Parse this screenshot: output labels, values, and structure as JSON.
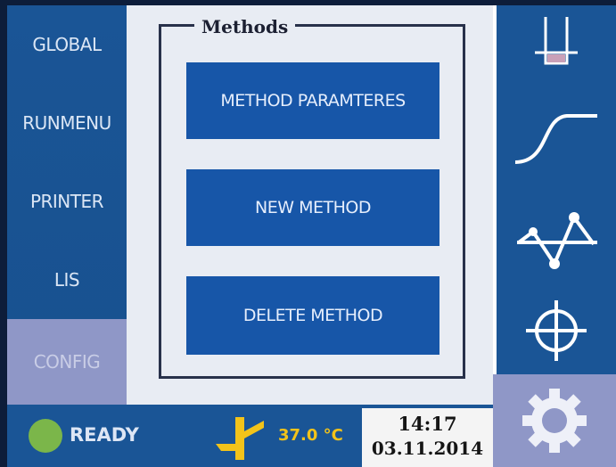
{
  "nav": {
    "items": [
      {
        "label": "GLOBAL",
        "active": false
      },
      {
        "label": "RUNMENU",
        "active": false
      },
      {
        "label": "PRINTER",
        "active": false
      },
      {
        "label": "LIS",
        "active": false
      },
      {
        "label": "CONFIG",
        "active": true
      }
    ]
  },
  "methods": {
    "title": "Methods",
    "buttons": [
      "METHOD PARAMTERES",
      "NEW METHOD",
      "DELETE METHOD"
    ]
  },
  "toolbar": {
    "icons": [
      "test-tube-icon",
      "sigmoid-curve-icon",
      "line-graph-icon",
      "crosshair-icon",
      "gear-icon"
    ]
  },
  "status": {
    "state": "READY",
    "temperature": "37.0 °C",
    "time": "14:17",
    "date": "03.11.2014"
  },
  "colors": {
    "primary_blue": "#1a5596",
    "button_blue": "#1756a8",
    "active_nav": "#8f97c7",
    "ready_green": "#7bb64a",
    "temperature_yellow": "#f2c31a"
  }
}
